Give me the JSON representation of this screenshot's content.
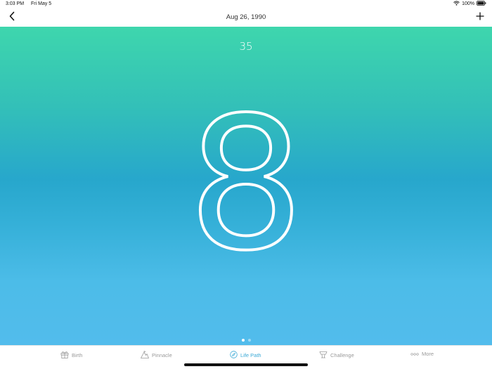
{
  "status_bar": {
    "time": "3:03 PM",
    "date": "Fri May 5",
    "battery": "100%"
  },
  "nav": {
    "title": "Aug 26, 1990",
    "back_icon": "chevron-left-icon",
    "add_icon": "plus-icon"
  },
  "hero": {
    "sub_number": "35",
    "main_number": "8",
    "page_index": 1,
    "page_count": 2
  },
  "tabs": [
    {
      "label": "Birth",
      "icon": "gift-icon",
      "active": false
    },
    {
      "label": "Pinnacle",
      "icon": "mountain-icon",
      "active": false
    },
    {
      "label": "Life Path",
      "icon": "compass-icon",
      "active": true
    },
    {
      "label": "Challenge",
      "icon": "challenge-icon",
      "active": false
    },
    {
      "label": "More",
      "icon": "more-icon",
      "active": false
    }
  ],
  "colors": {
    "gradient_top": "#3ed6ad",
    "gradient_mid": "#27a7cc",
    "gradient_bottom": "#52bcec",
    "tab_active": "#3aa9d6",
    "tab_inactive": "#9a9a9a"
  }
}
